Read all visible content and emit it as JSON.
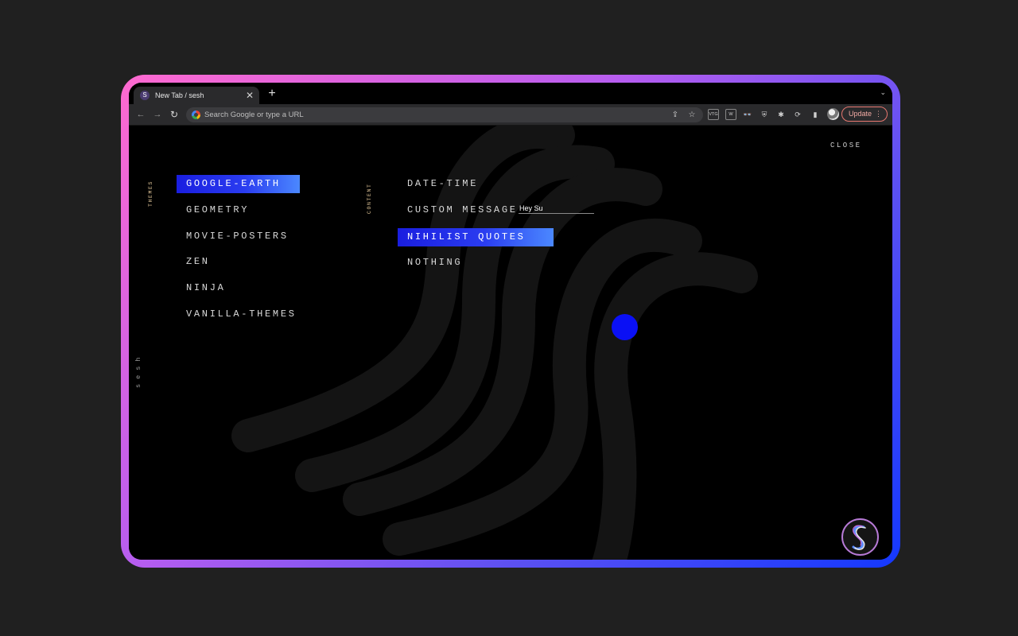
{
  "browser": {
    "tab_title": "New Tab / sesh",
    "tab_favicon": "S",
    "tab_close": "✕",
    "new_tab": "+",
    "tab_menu": "⌄",
    "omnibox_placeholder": "Search Google or type a URL",
    "update_label": "Update",
    "update_menu": "⋮",
    "extensions": [
      {
        "name": "vtg-extension-icon",
        "glyph": "VTG"
      },
      {
        "name": "wp-extension-icon",
        "glyph": "W"
      },
      {
        "name": "glasses-extension-icon",
        "glyph": "👓"
      },
      {
        "name": "shield-extension-icon",
        "glyph": "⛨"
      },
      {
        "name": "puzzle-extensions-icon",
        "glyph": "✱"
      },
      {
        "name": "sync-extension-icon",
        "glyph": "⟳"
      },
      {
        "name": "side-panel-icon",
        "glyph": "▮"
      }
    ]
  },
  "page": {
    "close_label": "CLOSE",
    "themes_label": "THEMES",
    "content_label": "CONTENT",
    "brand_label": "sesh",
    "themes": [
      {
        "label": "GOOGLE-EARTH",
        "active": true
      },
      {
        "label": "GEOMETRY",
        "active": false
      },
      {
        "label": "MOVIE-POSTERS",
        "active": false
      },
      {
        "label": "ZEN",
        "active": false
      },
      {
        "label": "NINJA",
        "active": false
      },
      {
        "label": "VANILLA-THEMES",
        "active": false
      }
    ],
    "content": [
      {
        "label": "DATE-TIME",
        "active": false
      },
      {
        "label": "CUSTOM MESSAGE",
        "active": false
      },
      {
        "label": "NIHILIST QUOTES",
        "active": true
      },
      {
        "label": "NOTHING",
        "active": false
      }
    ],
    "custom_message_value": "Hey Su"
  },
  "colors": {
    "accent_blue": "#1a1ee0",
    "label_gold": "#e4c89a",
    "frame_pink": "#ff6ad0",
    "frame_blue": "#1438ff"
  }
}
